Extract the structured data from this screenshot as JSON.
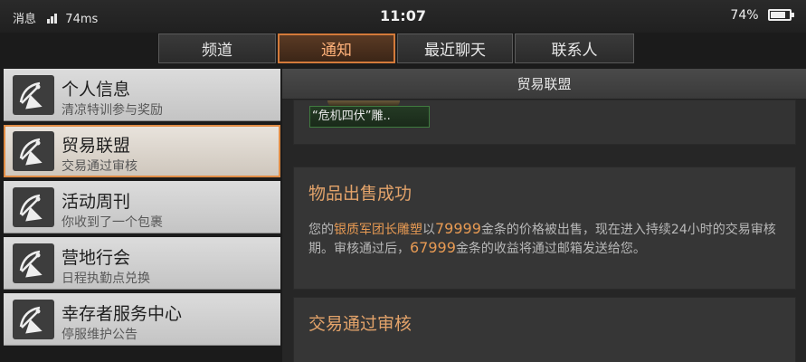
{
  "status": {
    "carrier": "消息",
    "ping": "74ms",
    "time": "11:07",
    "battery": "74%"
  },
  "tabs": [
    "频道",
    "通知",
    "最近聊天",
    "联系人"
  ],
  "active_tab": 1,
  "sidebar": {
    "items": [
      {
        "title": "个人信息",
        "subtitle": "清凉特训参与奖励"
      },
      {
        "title": "贸易联盟",
        "subtitle": "交易通过审核"
      },
      {
        "title": "活动周刊",
        "subtitle": "你收到了一个包裹"
      },
      {
        "title": "营地行会",
        "subtitle": "日程执勤点兑换"
      },
      {
        "title": "幸存者服务中心",
        "subtitle": "停服维护公告"
      }
    ]
  },
  "panel": {
    "header": "贸易联盟",
    "item_name": "“危机四伏”雕..",
    "messages": [
      {
        "title": "物品出售成功",
        "body_1": "您的",
        "item": "银质军团长雕塑",
        "body_2": "以",
        "price": "79999",
        "body_3": "金条的价格被出售，现在进入持续24小时的交易审核期。审核通过后，",
        "income": "67999",
        "body_4": "金条的收益将通过邮箱发送给您。"
      },
      {
        "title": "交易通过审核"
      }
    ]
  },
  "colors": {
    "accent": "#e08c45",
    "highlight": "#e79a53"
  }
}
